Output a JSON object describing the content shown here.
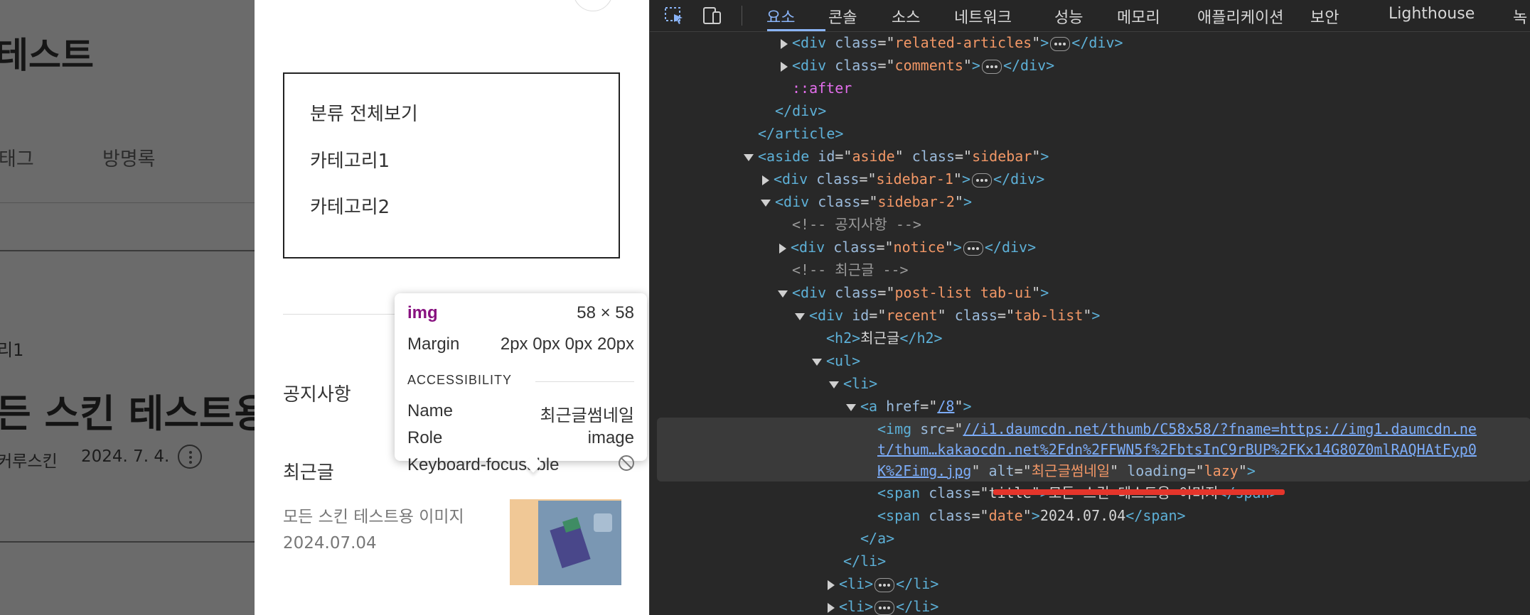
{
  "page": {
    "blog_title": "테스트",
    "nav": [
      "태그",
      "방명록"
    ],
    "post_category": "리1",
    "post_title": "든 스킨 테스트용",
    "post_author": "커루스킨",
    "post_date": "2024. 7. 4."
  },
  "sidebar": {
    "categories": [
      "분류 전체보기",
      "카테고리1",
      "카테고리2"
    ],
    "notice_label": "공지사항",
    "recent_label": "최근글",
    "recent_post": {
      "title": "모든 스킨 테스트용 이미지",
      "date": "2024.07.04",
      "thumbnail_alt": "최근글썸네일"
    }
  },
  "tooltip": {
    "tag": "img",
    "size": "58 × 58",
    "margin_label": "Margin",
    "margin_value": "2px 0px 0px 20px",
    "section": "ACCESSIBILITY",
    "name_label": "Name",
    "name_value": "최근글썸네일",
    "role_label": "Role",
    "role_value": "image",
    "keyboard_label": "Keyboard-focusable"
  },
  "devtools": {
    "tabs": [
      "요소",
      "콘솔",
      "소스",
      "네트워크",
      "성능",
      "메모리",
      "애플리케이션",
      "보안",
      "Lighthouse",
      "녹"
    ],
    "active_tab": "요소",
    "lines": [
      {
        "indent": 0,
        "t": "div",
        "cls": "related-articles",
        "collapsed": true
      },
      {
        "indent": 0,
        "t": "div",
        "cls": "comments",
        "collapsed": true
      },
      {
        "indent": 0,
        "pseudo": "::after"
      },
      {
        "close": "</div>"
      },
      {
        "close": "</article>"
      },
      {
        "open": "<aside",
        "id": "aside",
        "cls": "sidebar"
      },
      {
        "t": "div",
        "cls": "sidebar-1",
        "collapsed": true
      },
      {
        "open": "<div",
        "cls": "sidebar-2"
      },
      {
        "comment": "<!-- 공지사항 -->"
      },
      {
        "t": "div",
        "cls": "notice",
        "collapsed": true
      },
      {
        "comment": "<!-- 최근글 -->"
      },
      {
        "open": "<div",
        "cls": "post-list tab-ui"
      },
      {
        "open": "<div",
        "id": "recent",
        "cls": "tab-list"
      },
      {
        "h2": "최근글"
      },
      {
        "tag": "<ul>"
      },
      {
        "tag": "<li>"
      },
      {
        "href": "/8"
      },
      {
        "img_src_1": "//i1.daumcdn.net/thumb/C58x58/?fname=https://img1.daumcdn.ne",
        "img_src_2": "t/thum…kakaocdn.net%2Fdn%2FFWN5f%2FbtsInC9rBUP%2FKx14G80Z0mlRAQHAtFyp0",
        "img_src_3": "K%2Fimg.jpg",
        "alt": "최근글썸네일",
        "loading": "lazy"
      },
      {
        "span_title": "모든 스킨 테스트용 이미지"
      },
      {
        "span_date": "2024.07.04"
      },
      {
        "close": "</a>"
      },
      {
        "close": "</li>"
      },
      {
        "li_collapsed": true
      },
      {
        "li_collapsed": true
      }
    ]
  }
}
